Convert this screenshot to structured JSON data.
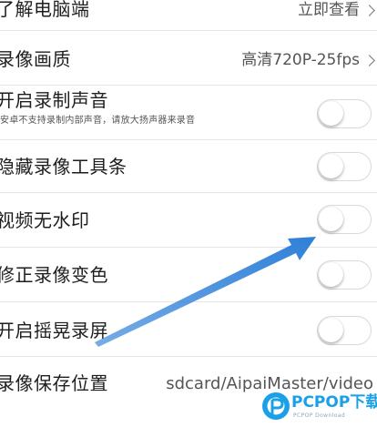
{
  "settings": {
    "rows": [
      {
        "label": "了解电脑端",
        "value": "立即查看"
      },
      {
        "label": "录像画质",
        "value": "高清720P-25fps"
      },
      {
        "label": "开启录制声音",
        "sublabel": "安卓不支持录制内部声音，请放大扬声器来录音",
        "toggle": false
      },
      {
        "label": "隐藏录像工具条",
        "toggle": false
      },
      {
        "label": "视频无水印",
        "toggle": false
      },
      {
        "label": "修正录像变色",
        "toggle": false
      },
      {
        "label": "开启摇晃录屏",
        "toggle": false
      },
      {
        "label": "录像保存位置",
        "value": "sdcard/AipaiMaster/video"
      }
    ]
  },
  "annotation": {
    "arrow_color": "#2f80d8",
    "arrow_target": "视频无水印 toggle"
  },
  "watermark": {
    "text": "PCPOP下载",
    "subtext": "PCPOP Download",
    "color": "#1aa0e8"
  }
}
